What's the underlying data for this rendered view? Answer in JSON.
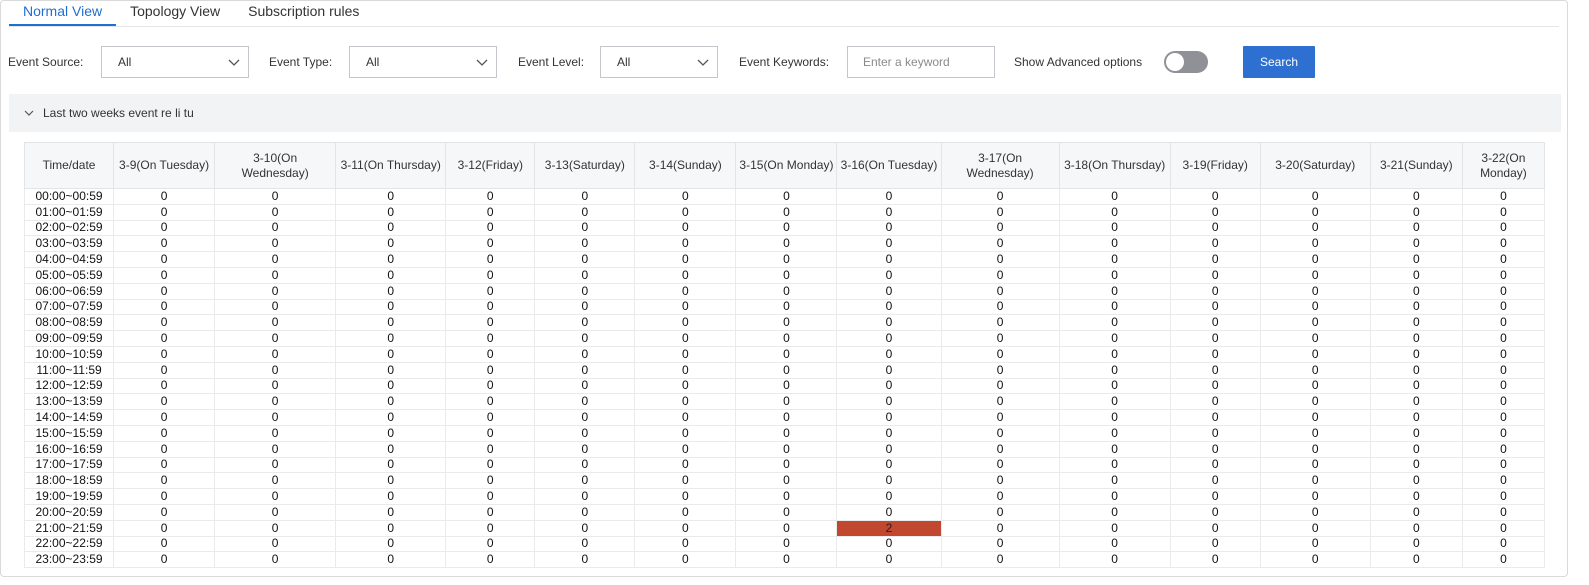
{
  "tabs": [
    {
      "label": "Normal View",
      "active": true
    },
    {
      "label": "Topology View",
      "active": false
    },
    {
      "label": "Subscription rules",
      "active": false
    }
  ],
  "filters": {
    "event_source": {
      "label": "Event Source:",
      "value": "All"
    },
    "event_type": {
      "label": "Event Type:",
      "value": "All"
    },
    "event_level": {
      "label": "Event Level:",
      "value": "All"
    },
    "keywords": {
      "label": "Event Keywords:",
      "placeholder": "Enter a keyword",
      "value": ""
    },
    "advanced": {
      "label": "Show Advanced options",
      "enabled": false
    },
    "search_label": "Search"
  },
  "panel": {
    "title": "Last two weeks event re li tu",
    "expanded": true
  },
  "colors": {
    "accent": "#2d70d1",
    "hot_cell": "#c1472f"
  },
  "table": {
    "corner": "Time/date",
    "columns": [
      "3-9(On Tuesday)",
      "3-10(On Wednesday)",
      "3-11(On Thursday)",
      "3-12(Friday)",
      "3-13(Saturday)",
      "3-14(Sunday)",
      "3-15(On Monday)",
      "3-16(On Tuesday)",
      "3-17(On Wednesday)",
      "3-18(On Thursday)",
      "3-19(Friday)",
      "3-20(Saturday)",
      "3-21(Sunday)",
      "3-22(On Monday)"
    ],
    "rows": [
      {
        "time": "00:00~00:59",
        "values": [
          0,
          0,
          0,
          0,
          0,
          0,
          0,
          0,
          0,
          0,
          0,
          0,
          0,
          0
        ]
      },
      {
        "time": "01:00~01:59",
        "values": [
          0,
          0,
          0,
          0,
          0,
          0,
          0,
          0,
          0,
          0,
          0,
          0,
          0,
          0
        ]
      },
      {
        "time": "02:00~02:59",
        "values": [
          0,
          0,
          0,
          0,
          0,
          0,
          0,
          0,
          0,
          0,
          0,
          0,
          0,
          0
        ]
      },
      {
        "time": "03:00~03:59",
        "values": [
          0,
          0,
          0,
          0,
          0,
          0,
          0,
          0,
          0,
          0,
          0,
          0,
          0,
          0
        ]
      },
      {
        "time": "04:00~04:59",
        "values": [
          0,
          0,
          0,
          0,
          0,
          0,
          0,
          0,
          0,
          0,
          0,
          0,
          0,
          0
        ]
      },
      {
        "time": "05:00~05:59",
        "values": [
          0,
          0,
          0,
          0,
          0,
          0,
          0,
          0,
          0,
          0,
          0,
          0,
          0,
          0
        ]
      },
      {
        "time": "06:00~06:59",
        "values": [
          0,
          0,
          0,
          0,
          0,
          0,
          0,
          0,
          0,
          0,
          0,
          0,
          0,
          0
        ]
      },
      {
        "time": "07:00~07:59",
        "values": [
          0,
          0,
          0,
          0,
          0,
          0,
          0,
          0,
          0,
          0,
          0,
          0,
          0,
          0
        ]
      },
      {
        "time": "08:00~08:59",
        "values": [
          0,
          0,
          0,
          0,
          0,
          0,
          0,
          0,
          0,
          0,
          0,
          0,
          0,
          0
        ]
      },
      {
        "time": "09:00~09:59",
        "values": [
          0,
          0,
          0,
          0,
          0,
          0,
          0,
          0,
          0,
          0,
          0,
          0,
          0,
          0
        ]
      },
      {
        "time": "10:00~10:59",
        "values": [
          0,
          0,
          0,
          0,
          0,
          0,
          0,
          0,
          0,
          0,
          0,
          0,
          0,
          0
        ]
      },
      {
        "time": "11:00~11:59",
        "values": [
          0,
          0,
          0,
          0,
          0,
          0,
          0,
          0,
          0,
          0,
          0,
          0,
          0,
          0
        ]
      },
      {
        "time": "12:00~12:59",
        "values": [
          0,
          0,
          0,
          0,
          0,
          0,
          0,
          0,
          0,
          0,
          0,
          0,
          0,
          0
        ]
      },
      {
        "time": "13:00~13:59",
        "values": [
          0,
          0,
          0,
          0,
          0,
          0,
          0,
          0,
          0,
          0,
          0,
          0,
          0,
          0
        ]
      },
      {
        "time": "14:00~14:59",
        "values": [
          0,
          0,
          0,
          0,
          0,
          0,
          0,
          0,
          0,
          0,
          0,
          0,
          0,
          0
        ]
      },
      {
        "time": "15:00~15:59",
        "values": [
          0,
          0,
          0,
          0,
          0,
          0,
          0,
          0,
          0,
          0,
          0,
          0,
          0,
          0
        ]
      },
      {
        "time": "16:00~16:59",
        "values": [
          0,
          0,
          0,
          0,
          0,
          0,
          0,
          0,
          0,
          0,
          0,
          0,
          0,
          0
        ]
      },
      {
        "time": "17:00~17:59",
        "values": [
          0,
          0,
          0,
          0,
          0,
          0,
          0,
          0,
          0,
          0,
          0,
          0,
          0,
          0
        ]
      },
      {
        "time": "18:00~18:59",
        "values": [
          0,
          0,
          0,
          0,
          0,
          0,
          0,
          0,
          0,
          0,
          0,
          0,
          0,
          0
        ]
      },
      {
        "time": "19:00~19:59",
        "values": [
          0,
          0,
          0,
          0,
          0,
          0,
          0,
          0,
          0,
          0,
          0,
          0,
          0,
          0
        ]
      },
      {
        "time": "20:00~20:59",
        "values": [
          0,
          0,
          0,
          0,
          0,
          0,
          0,
          0,
          0,
          0,
          0,
          0,
          0,
          0
        ]
      },
      {
        "time": "21:00~21:59",
        "values": [
          0,
          0,
          0,
          0,
          0,
          0,
          0,
          2,
          0,
          0,
          0,
          0,
          0,
          0
        ]
      },
      {
        "time": "22:00~22:59",
        "values": [
          0,
          0,
          0,
          0,
          0,
          0,
          0,
          0,
          0,
          0,
          0,
          0,
          0,
          0
        ]
      },
      {
        "time": "23:00~23:59",
        "values": [
          0,
          0,
          0,
          0,
          0,
          0,
          0,
          0,
          0,
          0,
          0,
          0,
          0,
          0
        ]
      }
    ]
  }
}
